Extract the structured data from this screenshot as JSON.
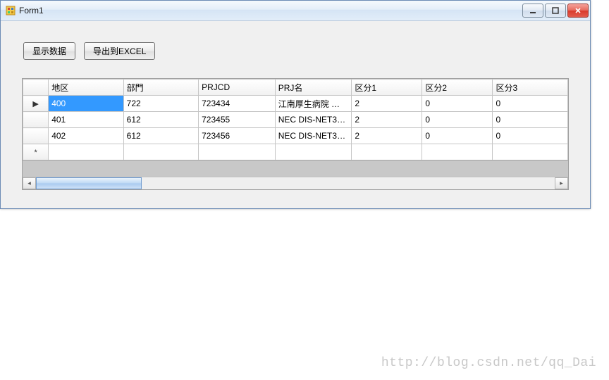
{
  "window": {
    "title": "Form1"
  },
  "buttons": {
    "show_data": "显示数据",
    "export_excel": "导出到EXCEL"
  },
  "grid": {
    "columns": [
      "地区",
      "部門",
      "PRJCD",
      "PRJ名",
      "区分1",
      "区分2",
      "区分3"
    ],
    "rows": [
      {
        "indicator": "▶",
        "cells": [
          "400",
          "722",
          "723434",
          "江南厚生病院 …",
          "2",
          "0",
          "0"
        ],
        "selected_col": 0
      },
      {
        "indicator": "",
        "cells": [
          "401",
          "612",
          "723455",
          "NEC DIS-NET3…",
          "2",
          "0",
          "0"
        ]
      },
      {
        "indicator": "",
        "cells": [
          "402",
          "612",
          "723456",
          "NEC DIS-NET3…",
          "2",
          "0",
          "0"
        ]
      },
      {
        "indicator": "*",
        "cells": [
          "",
          "",
          "",
          "",
          "",
          "",
          ""
        ]
      }
    ]
  },
  "watermark": "http://blog.csdn.net/qq_Dai"
}
